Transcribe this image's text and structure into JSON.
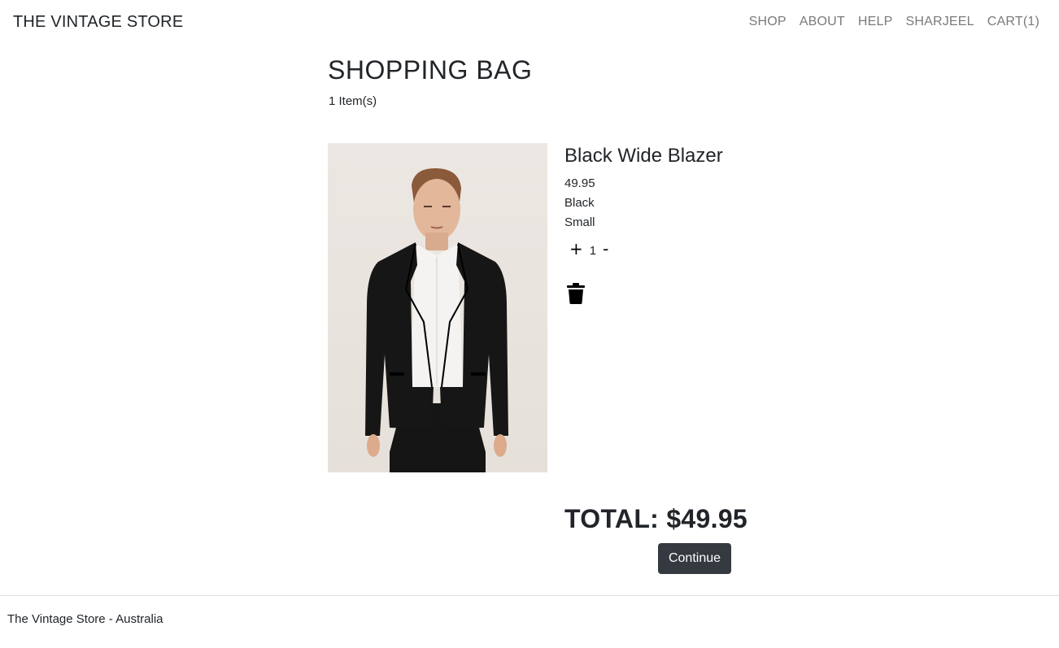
{
  "nav": {
    "brand": "THE VINTAGE STORE",
    "links": [
      "SHOP",
      "ABOUT",
      "HELP",
      "SHARJEEL",
      "CART(1)"
    ]
  },
  "bag": {
    "title": "SHOPPING BAG",
    "count": "1 Item(s)"
  },
  "item": {
    "name": "Black Wide Blazer",
    "price": "49.95",
    "color": "Black",
    "size": "Small",
    "quantity": "1",
    "plus": "+",
    "minus": "-",
    "image_icon": "product-photo-blazer"
  },
  "summary": {
    "total": "TOTAL: $49.95",
    "continue_label": "Continue"
  },
  "footer": {
    "text": "The Vintage Store - Australia"
  },
  "colors": {
    "button_bg": "#343a40",
    "nav_link": "#7a7a7a",
    "text": "#212529"
  }
}
